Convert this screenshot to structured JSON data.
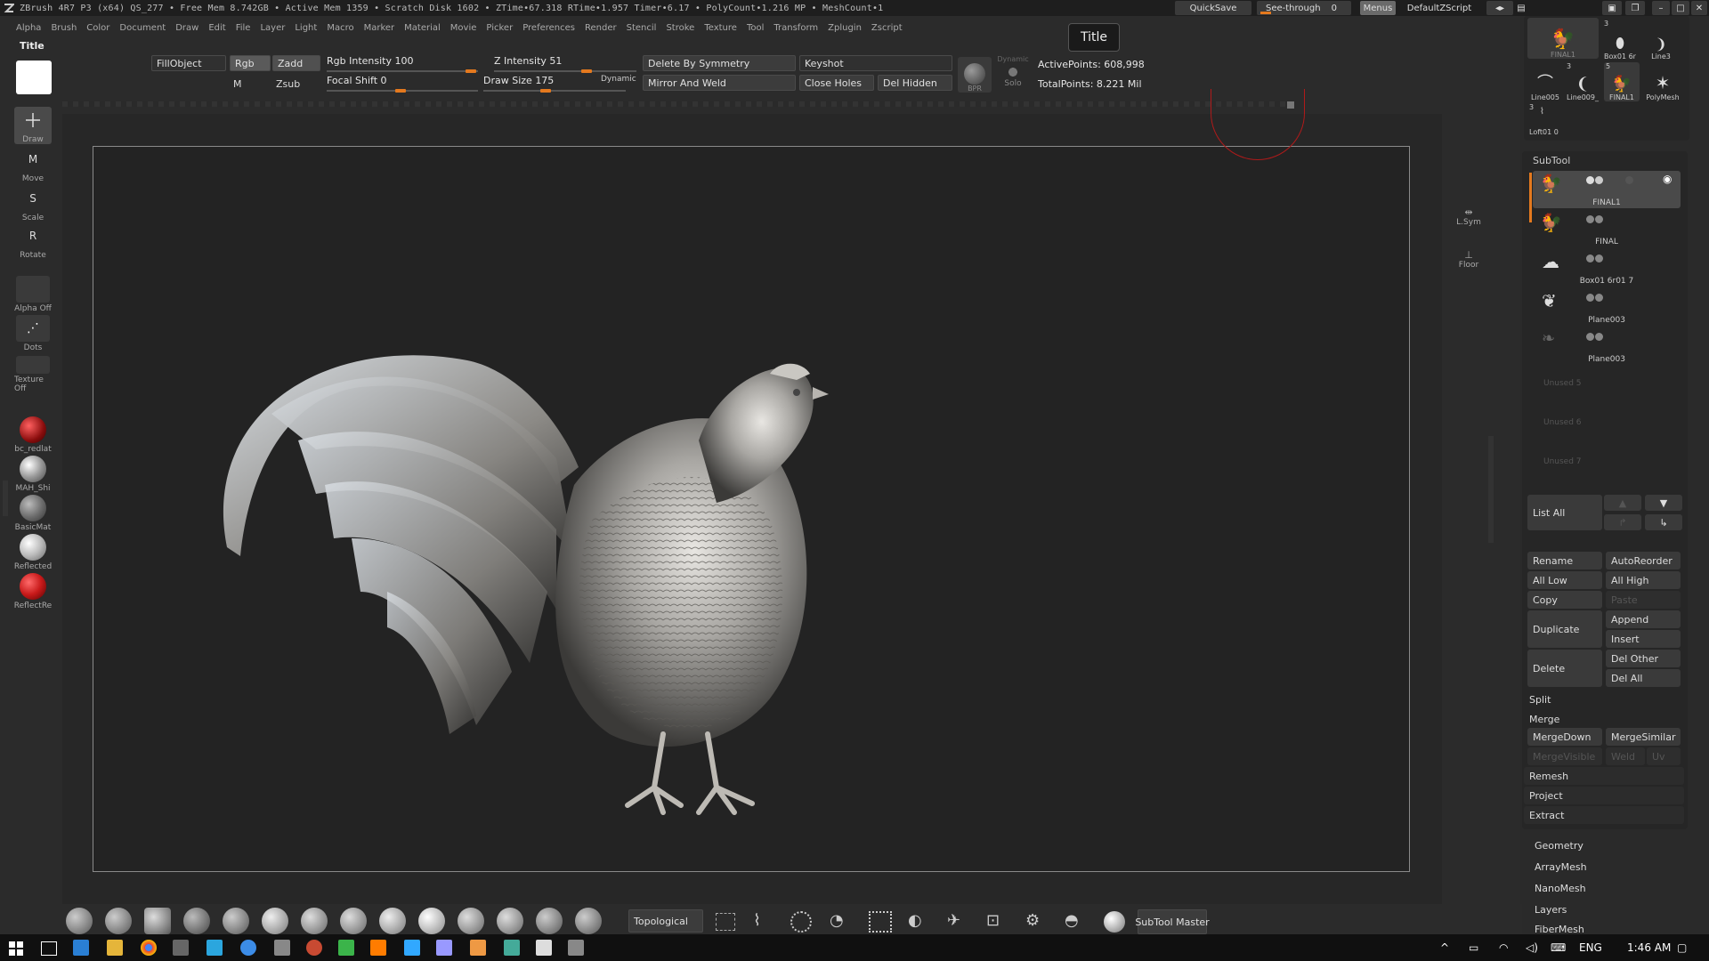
{
  "titlebar": {
    "text": "ZBrush 4R7 P3 (x64)    QS_277    • Free Mem 8.742GB • Active Mem 1359 • Scratch Disk 1602 •  ZTime•67.318 RTime•1.957 Timer•6.17 • PolyCount•1.216 MP  • MeshCount•1",
    "quicksave": "QuickSave",
    "see_through_label": "See-through",
    "see_through_value": "0",
    "menus": "Menus",
    "script": "DefaultZScript"
  },
  "menubar": [
    "Alpha",
    "Brush",
    "Color",
    "Document",
    "Draw",
    "Edit",
    "File",
    "Layer",
    "Light",
    "Macro",
    "Marker",
    "Material",
    "Movie",
    "Picker",
    "Preferences",
    "Render",
    "Stencil",
    "Stroke",
    "Texture",
    "Tool",
    "Transform",
    "Zplugin",
    "Zscript"
  ],
  "tooltip": "Title",
  "left_title": "Title",
  "top": {
    "fill_object": "FillObject",
    "rgb": "Rgb",
    "zadd": "Zadd",
    "m": "M",
    "zsub": "Zsub",
    "rgb_intensity_label": "Rgb Intensity",
    "rgb_intensity_value": "100",
    "focal_shift_label": "Focal Shift",
    "focal_shift_value": "0",
    "z_intensity_label": "Z Intensity",
    "z_intensity_value": "51",
    "draw_size_label": "Draw Size",
    "draw_size_value": "175",
    "dynamic": "Dynamic",
    "delete_by_symmetry": "Delete By Symmetry",
    "mirror_and_weld": "Mirror And Weld",
    "keyshot": "Keyshot",
    "close_holes": "Close Holes",
    "del_hidden": "Del Hidden",
    "bpr": "BPR",
    "dynamic_solo_top": "Dynamic",
    "solo": "Solo",
    "active_points": "ActivePoints: 608,998",
    "total_points": "TotalPoints: 8.221 Mil"
  },
  "left_tools": [
    {
      "label": "Draw",
      "icon": "draw-icon"
    },
    {
      "label": "Move",
      "icon": "move-icon"
    },
    {
      "label": "Scale",
      "icon": "scale-icon"
    },
    {
      "label": "Rotate",
      "icon": "rotate-icon"
    }
  ],
  "left_slots": {
    "alpha": "Alpha  Off",
    "dots": "Dots",
    "texture": "Texture  Off"
  },
  "materials": [
    {
      "label": "bc_redlat",
      "color": "#b01818"
    },
    {
      "label": "MAH_Shi",
      "color": "#c8c8c8"
    },
    {
      "label": "BasicMat",
      "color": "#8a8a8a"
    },
    {
      "label": "Reflected",
      "color": "#bdbdbd"
    },
    {
      "label": "ReflectRe",
      "color": "#c81a1a"
    }
  ],
  "right_gutter": {
    "lsym": "L.Sym",
    "floor": "Floor"
  },
  "tool_thumbs": [
    "FINAL1",
    "Box01 6r",
    "Line3",
    "Line005",
    "Line009_",
    "FINAL1",
    "PolyMesh"
  ],
  "thumb_counts": [
    "3",
    "3",
    "5",
    "3"
  ],
  "loft_label": "Loft01 0",
  "subtool": {
    "header": "SubTool",
    "items": [
      "FINAL1",
      "FINAL",
      "Box01 6r01 7",
      "Plane003",
      "Plane003"
    ],
    "unused": [
      "Unused 5",
      "Unused 6",
      "Unused 7"
    ],
    "list_all": "List All"
  },
  "subtool_buttons": {
    "rename": "Rename",
    "autoreorder": "AutoReorder",
    "all_low": "All Low",
    "all_high": "All High",
    "copy": "Copy",
    "paste": "Paste",
    "duplicate": "Duplicate",
    "append": "Append",
    "insert": "Insert",
    "delete": "Delete",
    "del_other": "Del Other",
    "del_all": "Del All",
    "split": "Split",
    "merge": "Merge",
    "mergedown": "MergeDown",
    "mergesimilar": "MergeSimilar",
    "mergevisible": "MergeVisible",
    "weld": "Weld",
    "uv": "Uv",
    "remesh": "Remesh",
    "project": "Project",
    "extract": "Extract"
  },
  "tool_sections": [
    "Geometry",
    "ArrayMesh",
    "NanoMesh",
    "Layers",
    "FiberMesh"
  ],
  "bottom": {
    "topological": "Topological",
    "subtool_master": "SubTool Master"
  },
  "taskbar": {
    "lang": "ENG",
    "time": "1:46 AM"
  },
  "colors": {
    "accent": "#e4791e",
    "panel": "#2a2a2a",
    "canvas": "#232323"
  }
}
